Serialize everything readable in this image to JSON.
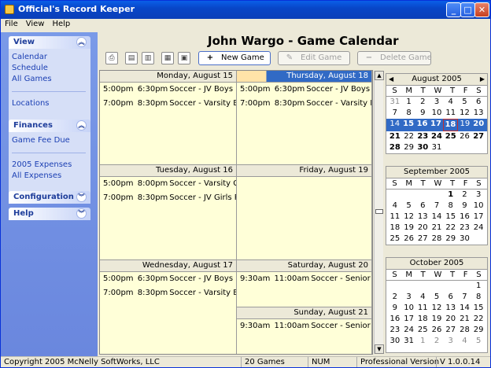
{
  "window": {
    "title": "Official's Record Keeper"
  },
  "menu": [
    "File",
    "View",
    "Help"
  ],
  "sidebar": {
    "view": {
      "title": "View",
      "items": [
        "Calendar",
        "Schedule",
        "All Games"
      ],
      "extra": [
        "Locations"
      ]
    },
    "finances": {
      "title": "Finances",
      "items": [
        "Game Fee Due"
      ],
      "extra": [
        "2005 Expenses",
        "All Expenses"
      ]
    },
    "configuration": {
      "title": "Configuration"
    },
    "help": {
      "title": "Help"
    }
  },
  "main": {
    "title": "John Wargo - Game Calendar",
    "buttons": {
      "new_game": "New Game",
      "edit_game": "Edit Game",
      "delete_game": "Delete Game"
    }
  },
  "days": [
    {
      "label": "Monday, August 15",
      "events": [
        [
          "5:00pm",
          "6:30pm",
          "Soccer - JV Boys R"
        ],
        [
          "7:00pm",
          "8:30pm",
          "Soccer - Varsity Bc"
        ]
      ]
    },
    {
      "label": "Thursday, August 18",
      "events": [
        [
          "5:00pm",
          "6:30pm",
          "Soccer - JV Boys 2-"
        ],
        [
          "7:00pm",
          "8:30pm",
          "Soccer - Varsity Bo"
        ]
      ]
    },
    {
      "label": "Tuesday, August 16",
      "events": [
        [
          "5:00pm",
          "8:00pm",
          "Soccer - Varsity Gi"
        ],
        [
          "7:00pm",
          "8:30pm",
          "Soccer - JV Girls R("
        ]
      ]
    },
    {
      "label": "Friday, August 19",
      "events": []
    },
    {
      "label": "Wednesday, August 17",
      "events": [
        [
          "5:00pm",
          "6:30pm",
          "Soccer - JV Boys R"
        ],
        [
          "7:00pm",
          "8:30pm",
          "Soccer - Varsity Bc"
        ]
      ]
    },
    {
      "label": "Saturday, August 20",
      "events": [
        [
          "9:30am",
          "11:00am",
          "Soccer - Senior Wc"
        ]
      ]
    },
    {
      "label": "Sunday, August 21",
      "events": [
        [
          "9:30am",
          "11:00am",
          "Soccer - Senior Me"
        ]
      ]
    }
  ],
  "calendars": [
    {
      "month": "August 2005",
      "weekdays": [
        "S",
        "M",
        "T",
        "W",
        "T",
        "F",
        "S"
      ],
      "rows": [
        [
          "31",
          "1",
          "2",
          "3",
          "4",
          "5",
          "6"
        ],
        [
          "7",
          "8",
          "9",
          "10",
          "11",
          "12",
          "13"
        ],
        [
          "14",
          "15",
          "16",
          "17",
          "18",
          "19",
          "20"
        ],
        [
          "21",
          "22",
          "23",
          "24",
          "25",
          "26",
          "27"
        ],
        [
          "28",
          "29",
          "30",
          "31",
          "",
          "",
          ""
        ]
      ]
    },
    {
      "month": "September 2005",
      "weekdays": [
        "S",
        "M",
        "T",
        "W",
        "T",
        "F",
        "S"
      ],
      "rows": [
        [
          "",
          "",
          "",
          "",
          "1",
          "2",
          "3"
        ],
        [
          "4",
          "5",
          "6",
          "7",
          "8",
          "9",
          "10"
        ],
        [
          "11",
          "12",
          "13",
          "14",
          "15",
          "16",
          "17"
        ],
        [
          "18",
          "19",
          "20",
          "21",
          "22",
          "23",
          "24"
        ],
        [
          "25",
          "26",
          "27",
          "28",
          "29",
          "30",
          ""
        ]
      ]
    },
    {
      "month": "October 2005",
      "weekdays": [
        "S",
        "M",
        "T",
        "W",
        "T",
        "F",
        "S"
      ],
      "rows": [
        [
          "",
          "",
          "",
          "",
          "",
          "",
          "1"
        ],
        [
          "2",
          "3",
          "4",
          "5",
          "6",
          "7",
          "8"
        ],
        [
          "9",
          "10",
          "11",
          "12",
          "13",
          "14",
          "15"
        ],
        [
          "16",
          "17",
          "18",
          "19",
          "20",
          "21",
          "22"
        ],
        [
          "23",
          "24",
          "25",
          "26",
          "27",
          "28",
          "29"
        ],
        [
          "30",
          "31",
          "1",
          "2",
          "3",
          "4",
          "5"
        ]
      ]
    }
  ],
  "status": {
    "copyright": "Copyright 2005 McNelly SoftWorks, LLC",
    "count": "20 Games",
    "num": "NUM",
    "edition": "Professional Version",
    "version": "V 1.0.0.14"
  }
}
